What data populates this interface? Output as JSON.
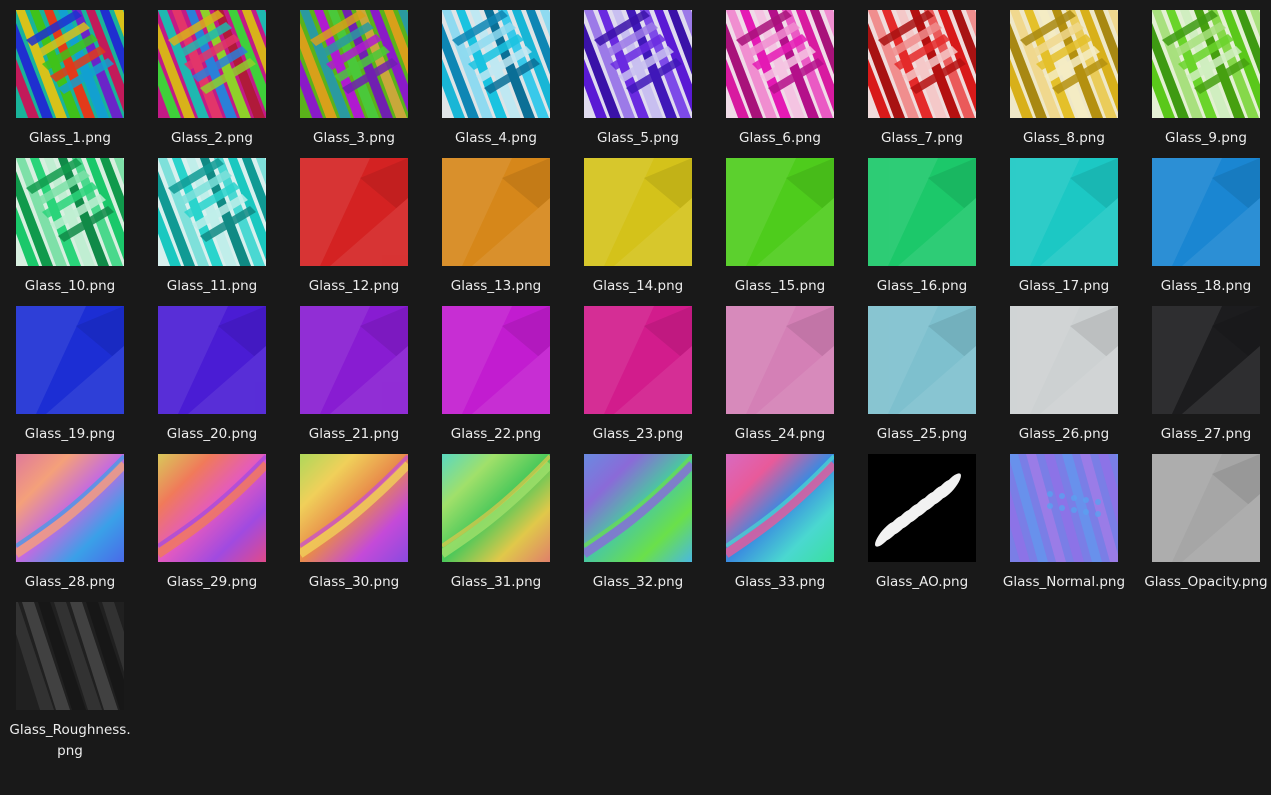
{
  "window": {
    "view": "Large icons",
    "background": "#191919"
  },
  "files": [
    {
      "name": "Glass_1.png",
      "kind": "stripes",
      "colors": [
        "#19b39a",
        "#c21a5a",
        "#1f2fd0",
        "#d8c21a",
        "#3fc21a",
        "#e23a1a",
        "#12a0d0",
        "#6a24c8"
      ]
    },
    {
      "name": "Glass_2.png",
      "kind": "stripes",
      "colors": [
        "#c21a86",
        "#3fd03a",
        "#d8b21a",
        "#1fb8b0",
        "#e2356a",
        "#2a80d8",
        "#8fd02a",
        "#b01a3a"
      ]
    },
    {
      "name": "Glass_3.png",
      "kind": "stripes",
      "colors": [
        "#5ab21a",
        "#8a1ac8",
        "#d8a01a",
        "#2a9aa0",
        "#b01ad0",
        "#4ac83a",
        "#7020b0",
        "#c8a83a"
      ]
    },
    {
      "name": "Glass_4.png",
      "kind": "stripes",
      "colors": [
        "#dfe4e6",
        "#18b6d6",
        "#0e86b4",
        "#8fdaf0",
        "#1ac3e0",
        "#bfe8f2",
        "#0b6f96",
        "#39c9ea"
      ]
    },
    {
      "name": "Glass_5.png",
      "kind": "stripes",
      "colors": [
        "#e0dcef",
        "#5a1ad4",
        "#3a12a8",
        "#9c7ae8",
        "#6a2ae0",
        "#c8bff0",
        "#4018b8",
        "#7d4ae8"
      ]
    },
    {
      "name": "Glass_6.png",
      "kind": "stripes",
      "colors": [
        "#f0dce8",
        "#d81aa0",
        "#a8127a",
        "#f08ed0",
        "#e41ab4",
        "#f4c4e2",
        "#b4108a",
        "#ea5ac4"
      ]
    },
    {
      "name": "Glass_7.png",
      "kind": "stripes",
      "colors": [
        "#f0dcdc",
        "#d81a1a",
        "#a81212",
        "#f08e8e",
        "#e42a2a",
        "#f4c8c8",
        "#b41010",
        "#ea5a5a"
      ]
    },
    {
      "name": "Glass_8.png",
      "kind": "stripes",
      "colors": [
        "#efe8c8",
        "#d8b01a",
        "#a88812",
        "#f0d88e",
        "#e4c02a",
        "#f4ecc4",
        "#b49010",
        "#eacc5a"
      ]
    },
    {
      "name": "Glass_9.png",
      "kind": "stripes",
      "colors": [
        "#e4f0d4",
        "#5ac81a",
        "#3e9a12",
        "#a8e07e",
        "#6ad42a",
        "#d0eec0",
        "#46a010",
        "#86d84a"
      ]
    },
    {
      "name": "Glass_10.png",
      "kind": "stripes",
      "colors": [
        "#d8efe0",
        "#1ac86a",
        "#109a4c",
        "#7ee0a8",
        "#2ad47a",
        "#c0eed2",
        "#108a48",
        "#4ad88c"
      ]
    },
    {
      "name": "Glass_11.png",
      "kind": "stripes",
      "colors": [
        "#d8f0ee",
        "#1ac8c0",
        "#109a94",
        "#7ee0da",
        "#2ad4cc",
        "#c0eeea",
        "#108a84",
        "#4ad8d2"
      ]
    },
    {
      "name": "Glass_12.png",
      "kind": "solid",
      "colors": [
        "#d42222"
      ]
    },
    {
      "name": "Glass_13.png",
      "kind": "solid",
      "colors": [
        "#d6871a"
      ]
    },
    {
      "name": "Glass_14.png",
      "kind": "solid",
      "colors": [
        "#d4c21a"
      ]
    },
    {
      "name": "Glass_15.png",
      "kind": "solid",
      "colors": [
        "#4ecc1c"
      ]
    },
    {
      "name": "Glass_16.png",
      "kind": "solid",
      "colors": [
        "#1cc86a"
      ]
    },
    {
      "name": "Glass_17.png",
      "kind": "solid",
      "colors": [
        "#1cc8c4"
      ]
    },
    {
      "name": "Glass_18.png",
      "kind": "solid",
      "colors": [
        "#1a86d2"
      ]
    },
    {
      "name": "Glass_19.png",
      "kind": "solid",
      "colors": [
        "#1c2ed4"
      ]
    },
    {
      "name": "Glass_20.png",
      "kind": "solid",
      "colors": [
        "#4a1cd4"
      ]
    },
    {
      "name": "Glass_21.png",
      "kind": "solid",
      "colors": [
        "#881cd2"
      ]
    },
    {
      "name": "Glass_22.png",
      "kind": "solid",
      "colors": [
        "#c21cd0"
      ]
    },
    {
      "name": "Glass_23.png",
      "kind": "solid",
      "colors": [
        "#d21c8c"
      ]
    },
    {
      "name": "Glass_24.png",
      "kind": "solid",
      "colors": [
        "#d480b6"
      ]
    },
    {
      "name": "Glass_25.png",
      "kind": "solid",
      "colors": [
        "#7ec0ce"
      ]
    },
    {
      "name": "Glass_26.png",
      "kind": "solid",
      "colors": [
        "#cdd1d2"
      ]
    },
    {
      "name": "Glass_27.png",
      "kind": "solid",
      "colors": [
        "#1c1c1e"
      ]
    },
    {
      "name": "Glass_28.png",
      "kind": "gradient",
      "colors": [
        "#e07a9a",
        "#f4a07a",
        "#c46ae0",
        "#3aa0e8",
        "#4a6ae8"
      ]
    },
    {
      "name": "Glass_29.png",
      "kind": "gradient",
      "colors": [
        "#d8c85a",
        "#f07a5a",
        "#e45ac0",
        "#a04ae0",
        "#e04a8a"
      ]
    },
    {
      "name": "Glass_30.png",
      "kind": "gradient",
      "colors": [
        "#aed85a",
        "#f0d05a",
        "#e88a4a",
        "#c44ad8",
        "#8a4ae0"
      ]
    },
    {
      "name": "Glass_31.png",
      "kind": "gradient",
      "colors": [
        "#5ad8c0",
        "#a0e06a",
        "#4ac85a",
        "#e0c84a",
        "#e0806a"
      ]
    },
    {
      "name": "Glass_32.png",
      "kind": "gradient",
      "colors": [
        "#6a8ae0",
        "#8a6ad8",
        "#4ac8a0",
        "#6ae04a",
        "#4ab8e0"
      ]
    },
    {
      "name": "Glass_33.png",
      "kind": "gradient",
      "colors": [
        "#d86ac0",
        "#e85a9a",
        "#3a8ae0",
        "#4ad8d0",
        "#3ae0a0"
      ]
    },
    {
      "name": "Glass_AO.png",
      "kind": "ao",
      "colors": [
        "#000000",
        "#f2f2f2"
      ]
    },
    {
      "name": "Glass_Normal.png",
      "kind": "normal",
      "colors": [
        "#7a7ee6",
        "#9a6ae8",
        "#5aa0f0",
        "#b47ae8"
      ]
    },
    {
      "name": "Glass_Opacity.png",
      "kind": "solid",
      "colors": [
        "#a6a6a6"
      ]
    },
    {
      "name": "Glass_Roughness.png",
      "kind": "rough",
      "colors": [
        "#202020",
        "#3a3a3a",
        "#505050",
        "#141414"
      ]
    }
  ]
}
